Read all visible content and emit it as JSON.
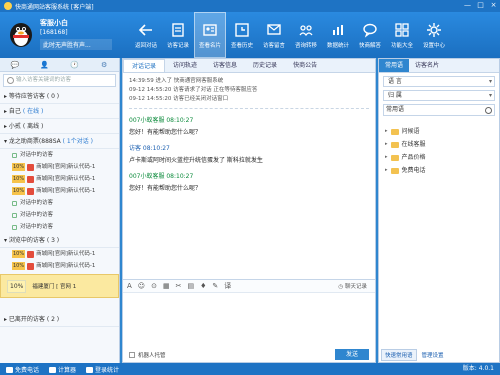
{
  "window": {
    "title": "快商通网站客服系统 [客户端]",
    "min": "—",
    "max": "□",
    "close": "×"
  },
  "profile": {
    "name": "客服小白",
    "id": "[168168]",
    "message": "此时无声胜有声..."
  },
  "toolbar": [
    {
      "label": "返回对话",
      "icon": "back-arrow-icon"
    },
    {
      "label": "访客记录",
      "icon": "document-icon"
    },
    {
      "label": "查看名片",
      "icon": "card-icon",
      "active": true
    },
    {
      "label": "查看历史",
      "icon": "clock-icon"
    },
    {
      "label": "访客留言",
      "icon": "message-icon"
    },
    {
      "label": "咨询转移",
      "icon": "transfer-icon"
    },
    {
      "label": "数据统计",
      "icon": "chart-icon"
    },
    {
      "label": "快商解答",
      "icon": "chat-icon"
    },
    {
      "label": "功能大全",
      "icon": "grid-icon"
    },
    {
      "label": "设置中心",
      "icon": "gear-icon"
    }
  ],
  "left": {
    "tabs": [
      "💬",
      "👤",
      "🕐",
      "⚙"
    ],
    "search_placeholder": "输入访客关键词的访客",
    "groups": {
      "waiting": "等待应答访客 ( 0 )",
      "self": "自己",
      "self_status": "( 在线 )",
      "xiaoyi": "小贰",
      "xiaoyi_status": "( 离线 )",
      "dept": "龙之助商票(888SA",
      "dept_status": "( 1个对话 )",
      "browsing": "浏览中的访客 ( 3 )",
      "left": "已离开的访客 ( 2 )"
    },
    "dept_items": [
      "对话中的访客",
      "商城网[官网]新认代码-1",
      "商城网[官网]新认代码-1",
      "商城网[官网]新认代码-1",
      "对话中的访客",
      "对话中的访客",
      "对话中的访客"
    ],
    "browse_items": [
      "商城网[官网]新认代码-1",
      "商城网[官网]新认代码-1"
    ],
    "selected": {
      "tag": "10%",
      "line1": "福建厦门 [ 官网 1",
      "line2": ""
    }
  },
  "mid": {
    "tabs": [
      "对话记录",
      "访问轨迹",
      "访客信息",
      "历史记录",
      "快商公告"
    ],
    "system": [
      "14:39:59 进入了 快商通官网客服系统",
      "09-12  14:55:20 访客请求了对话 正在等待客服应答",
      "09-12  14:55:20 访客已经关闭对话窗口"
    ],
    "messages": [
      {
        "who": "007小蚁客服  08:10:27",
        "text": "您好！有能帮助您什么呢？",
        "color": "green"
      },
      {
        "who": "访客  08:10:27",
        "text": "卢卡斯或阿时间火蓝控升统信蛋发了 斯科拉就发生",
        "color": "blue"
      },
      {
        "who": "007小蚁客服  08:10:27",
        "text": "您好！有能帮助您什么呢？",
        "color": "green"
      }
    ],
    "tools": [
      "A",
      "☺",
      "⊙",
      "▦",
      "✂",
      "▤",
      "♦",
      "✎",
      "译"
    ],
    "history": "聊天记录",
    "robot": "机器人托管",
    "send": "发送"
  },
  "right": {
    "tabs": [
      "常用语",
      "访客名片"
    ],
    "lang_label": "语  言",
    "owner_label": "归  属",
    "search_value": "常用语",
    "tree": [
      "问候语",
      "在线客服",
      "产品价格",
      "免费电话"
    ],
    "btn1": "快速常用语",
    "btn2": "管理设置"
  },
  "status": {
    "items": [
      "免费电话",
      "计算器",
      "登录统计"
    ],
    "version": "版本: 4.0.1"
  }
}
